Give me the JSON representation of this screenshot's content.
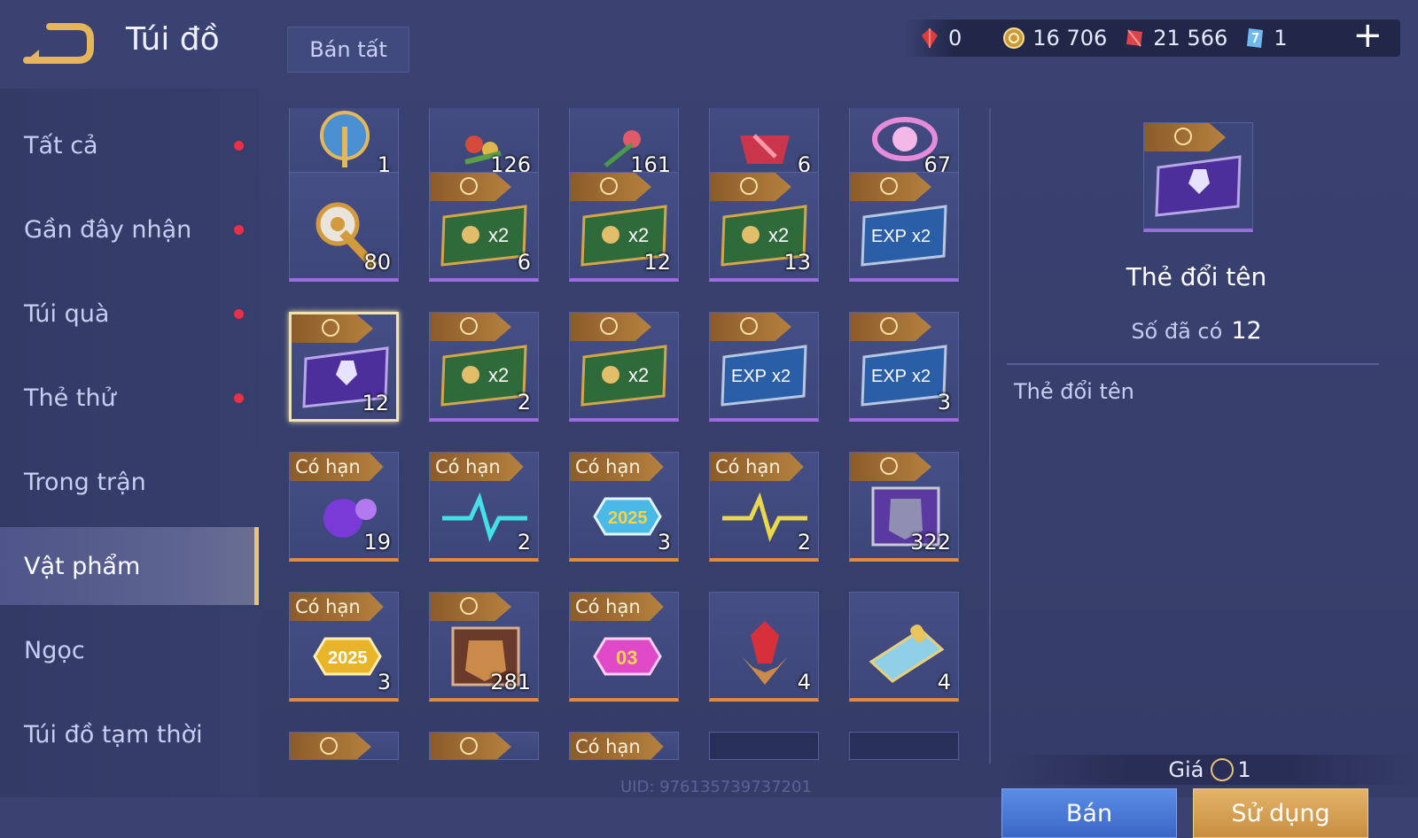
{
  "header": {
    "title": "Túi đồ",
    "sell_all": "Bán tất"
  },
  "currencies": [
    {
      "icon": "red-gem-icon",
      "value": "0"
    },
    {
      "icon": "gold-coin-icon",
      "value": "16 706"
    },
    {
      "icon": "ruby-icon",
      "value": "21 566"
    },
    {
      "icon": "voucher-icon",
      "value": "1"
    }
  ],
  "sidebar": {
    "items": [
      {
        "label": "Tất cả",
        "dot": true
      },
      {
        "label": "Gần đây nhận",
        "dot": true
      },
      {
        "label": "Túi quà",
        "dot": true
      },
      {
        "label": "Thẻ thử",
        "dot": true
      },
      {
        "label": "Trong trận",
        "dot": false
      },
      {
        "label": "Vật phẩm",
        "dot": false,
        "active": true
      },
      {
        "label": "Ngọc",
        "dot": false
      },
      {
        "label": "Túi đồ tạm thời",
        "dot": false
      }
    ]
  },
  "grid": {
    "limited_label": "Có hạn",
    "rows": [
      [
        {
          "count": "1",
          "icon": "amulet-icon"
        },
        {
          "count": "126",
          "icon": "flower-bouquet-icon"
        },
        {
          "count": "161",
          "icon": "rose-icon"
        },
        {
          "count": "6",
          "icon": "gift-box-icon"
        },
        {
          "count": "67",
          "icon": "orb-icon"
        }
      ],
      [
        {
          "count": "80",
          "icon": "trophy-scepter-icon"
        },
        {
          "count": "6",
          "icon": "gold-x2-card-icon",
          "tag": "coin"
        },
        {
          "count": "12",
          "icon": "gold-x2-card-icon",
          "tag": "coin"
        },
        {
          "count": "13",
          "icon": "gold-x2-card-icon",
          "tag": "coin"
        },
        {
          "count": "",
          "icon": "exp-x2-card-icon",
          "tag": "coin"
        }
      ],
      [
        {
          "count": "12",
          "icon": "rename-card-icon",
          "tag": "coin",
          "selected": true
        },
        {
          "count": "2",
          "icon": "gold-x2-card-icon",
          "tag": "coin"
        },
        {
          "count": "",
          "icon": "gold-x2-card-icon",
          "tag": "coin"
        },
        {
          "count": "",
          "icon": "exp-x2-card-icon",
          "tag": "coin"
        },
        {
          "count": "3",
          "icon": "exp-x2-card-icon",
          "tag": "coin"
        }
      ],
      [
        {
          "count": "19",
          "icon": "purple-glove-icon",
          "tag": "limited"
        },
        {
          "count": "2",
          "icon": "pulse-blue-icon",
          "tag": "limited"
        },
        {
          "count": "3",
          "icon": "badge-2025-blue-icon",
          "tag": "limited"
        },
        {
          "count": "2",
          "icon": "pulse-yellow-icon",
          "tag": "limited"
        },
        {
          "count": "322",
          "icon": "helmet-card-icon",
          "tag": "coin"
        }
      ],
      [
        {
          "count": "3",
          "icon": "badge-2025-gold-icon",
          "tag": "limited"
        },
        {
          "count": "281",
          "icon": "armor-card-icon",
          "tag": "coin"
        },
        {
          "count": "",
          "icon": "badge-03-pink-icon",
          "tag": "limited"
        },
        {
          "count": "4",
          "icon": "red-crystal-icon"
        },
        {
          "count": "4",
          "icon": "scroll-icon"
        }
      ]
    ],
    "badge_2025": "2025",
    "badge_03": "03",
    "x2_label": "x2",
    "exp_label": "EXP"
  },
  "detail": {
    "name": "Thẻ đổi tên",
    "owned_label": "Số đã có",
    "owned_value": "12",
    "description": "Thẻ đổi tên",
    "price_label": "Giá",
    "price_value": "1",
    "sell_label": "Bán",
    "use_label": "Sử dụng"
  },
  "uid": "UID: 976135739737201"
}
